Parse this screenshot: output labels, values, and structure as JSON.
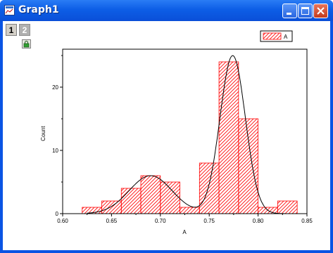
{
  "window": {
    "title": "Graph1"
  },
  "layers": {
    "tabs": [
      "1",
      "2"
    ],
    "active": "1"
  },
  "icons": {
    "app": "graph-window-icon",
    "minimize": "minimize-icon",
    "maximize": "maximize-icon",
    "close": "close-icon",
    "lock": "lock-icon"
  },
  "colors": {
    "bar_fill": "#ff0000",
    "curve": "#000000"
  },
  "chart_data": {
    "type": "bar",
    "xlabel": "A",
    "ylabel": "Count",
    "xlim": [
      0.6,
      0.85
    ],
    "ylim": [
      0,
      26
    ],
    "xticks": [
      "0.60",
      "0.65",
      "0.70",
      "0.75",
      "0.80",
      "0.85"
    ],
    "yticks": [
      "0",
      "10",
      "20"
    ],
    "bin_width": 0.01,
    "bins": [
      0.62,
      0.63,
      0.64,
      0.65,
      0.66,
      0.67,
      0.68,
      0.69,
      0.7,
      0.71,
      0.72,
      0.73,
      0.74,
      0.75,
      0.76,
      0.77,
      0.78,
      0.79,
      0.8,
      0.81,
      0.82,
      0.83
    ],
    "values": [
      1,
      2,
      4,
      6,
      5,
      1,
      8,
      24,
      15,
      1,
      2
    ],
    "bin_starts": [
      0.62,
      0.64,
      0.66,
      0.68,
      0.7,
      0.72,
      0.74,
      0.76,
      0.78,
      0.8,
      0.82
    ],
    "series": [
      {
        "name": "A",
        "values": [
          1,
          2,
          4,
          6,
          5,
          1,
          8,
          24,
          15,
          1,
          2
        ]
      }
    ],
    "fit_curve": {
      "peaks": [
        {
          "center": 0.69,
          "height": 6
        },
        {
          "center": 0.774,
          "height": 25
        }
      ]
    },
    "legend": {
      "position": "top-right",
      "entries": [
        "A"
      ]
    },
    "grid": false
  }
}
